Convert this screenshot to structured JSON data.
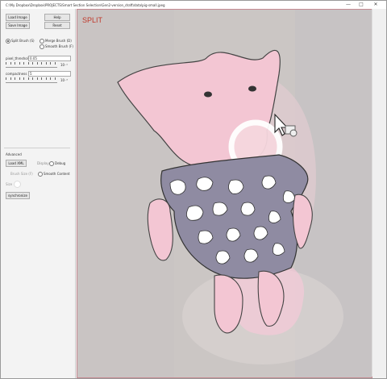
{
  "window": {
    "title": "C:\\My Dropbox\\Dropbox\\PROJECTS\\Smart Section Selection\\Gen2-version_draft\\data\\pig-small.jpeg",
    "minimize": "—",
    "maximize": "□",
    "close": "✕"
  },
  "controls": {
    "load_image": "Load Image",
    "help": "Help",
    "save_image": "Save Image",
    "reset": "Reset",
    "brush_options": [
      {
        "label": "Split Brush (S)",
        "checked": true
      },
      {
        "label": "Merge Brush (D)",
        "checked": false
      },
      {
        "label": "Smooth Brush (F)",
        "checked": false
      }
    ],
    "pixel_threshold_label": "pixel_threshold",
    "pixel_threshold_value": "0.05",
    "pixel_threshold_exponent": "10⁻¹",
    "compactness_label": "compactness",
    "compactness_value": "5",
    "compactness_exponent": "10⁻³",
    "advanced_label": "Advanced",
    "load_xml": "Load XML",
    "display_label": "Display",
    "debug_label": "Debug",
    "brush_size_label": "Brush Size (F)",
    "smooth_content_label": "Smooth Content",
    "size_label": "Size",
    "synchronize": "synchronize"
  },
  "viewer": {
    "mode_label": "SPLIT"
  },
  "colors": {
    "accent": "#c0392b",
    "frame": "#c58a92"
  }
}
